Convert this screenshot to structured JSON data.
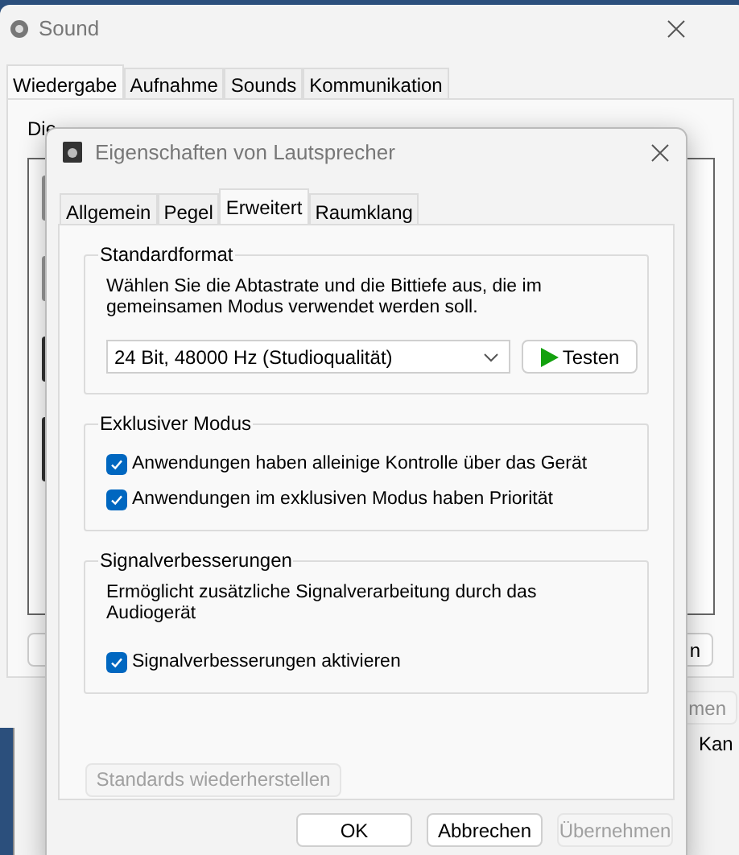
{
  "sound_window": {
    "title": "Sound",
    "tabs": [
      {
        "label": "Wiedergabe",
        "selected": true
      },
      {
        "label": "Aufnahme",
        "selected": false
      },
      {
        "label": "Sounds",
        "selected": false
      },
      {
        "label": "Kommunikation",
        "selected": false
      }
    ],
    "intro": "Die",
    "right_button": "n",
    "bottom_button": "men"
  },
  "background_window": {
    "text": "Kan"
  },
  "dialog": {
    "title": "Eigenschaften von Lautsprecher",
    "tabs": [
      {
        "label": "Allgemein",
        "selected": false
      },
      {
        "label": "Pegel",
        "selected": false
      },
      {
        "label": "Erweitert",
        "selected": true
      },
      {
        "label": "Raumklang",
        "selected": false
      }
    ],
    "groups": [
      {
        "kind": "format",
        "title": "Standardformat",
        "description": "Wählen Sie die Abtastrate und die Bittiefe aus, die im gemeinsamen Modus verwendet werden soll.",
        "format": "24 Bit, 48000 Hz (Studioqualität)",
        "test_button": "Testen"
      },
      {
        "kind": "checks",
        "title": "Exklusiver Modus",
        "options": [
          {
            "label": "Anwendungen haben alleinige Kontrolle über das Gerät",
            "checked": true
          },
          {
            "label": "Anwendungen im exklusiven Modus haben Priorität",
            "checked": true
          }
        ]
      },
      {
        "kind": "checks",
        "title": "Signalverbesserungen",
        "description": "Ermöglicht zusätzliche Signalverarbeitung durch das Audiogerät",
        "options": [
          {
            "label": "Signalverbesserungen aktivieren",
            "checked": true
          }
        ]
      }
    ],
    "restore_button": {
      "label": "Standards wiederherstellen",
      "disabled": true
    },
    "buttons": [
      {
        "label": "OK",
        "disabled": false
      },
      {
        "label": "Abbrechen",
        "disabled": false
      },
      {
        "label": "Übernehmen",
        "disabled": true
      }
    ]
  }
}
